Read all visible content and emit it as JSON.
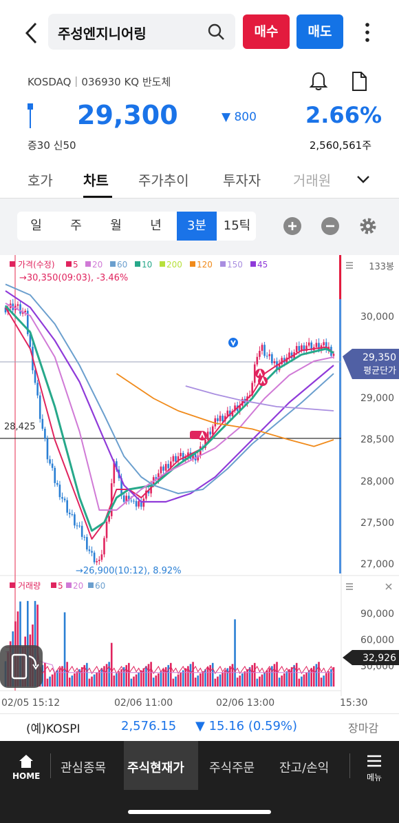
{
  "header": {
    "search_text": "주성엔지니어링",
    "buy_label": "매수",
    "sell_label": "매도"
  },
  "stock": {
    "market_line": "KOSDAQ｜036930 KQ 반도체",
    "price": "29,300",
    "change": "800",
    "change_pct": "2.66%",
    "margin": "증30  신50",
    "volume": "2,560,561주"
  },
  "tabs": [
    "호가",
    "차트",
    "주가추이",
    "투자자",
    "거래원"
  ],
  "period": [
    "일",
    "주",
    "월",
    "년",
    "3분",
    "15틱"
  ],
  "chart_data": {
    "type": "line",
    "legend": {
      "price": "가격(수정)",
      "ma": [
        "5",
        "20",
        "60",
        "10",
        "200",
        "120",
        "150",
        "45"
      ],
      "ma_colors": [
        "#e0245e",
        "#d07ad6",
        "#6b9fce",
        "#27a88a",
        "#b7e03b",
        "#f08a1a",
        "#a98ee0",
        "#8f3ad9"
      ]
    },
    "high_note": "→30,350(09:03), -3.46%",
    "low_note": "→26,900(10:12), 8.92%",
    "ref_level": "28,425",
    "bar_count": "133봉",
    "y_ticks": [
      "30,000",
      "29,500",
      "29,000",
      "28,500",
      "28,000",
      "27,500",
      "27,000"
    ],
    "ylim": [
      26900,
      30550
    ],
    "current_price": "29,350",
    "avg_label": "평균단가",
    "volume": {
      "legend_label": "거래량",
      "ma": [
        "5",
        "20",
        "60"
      ],
      "y_ticks": [
        "90,000",
        "60,000",
        "30,000"
      ],
      "current": "32,926"
    },
    "x_ticks": [
      "02/05 15:12",
      "02/06 11:00",
      "02/06 13:00",
      "15:30"
    ],
    "price_path": [
      [
        0,
        30100
      ],
      [
        4,
        30120
      ],
      [
        8,
        30000
      ],
      [
        11,
        29400
      ],
      [
        14,
        28800
      ],
      [
        17,
        28300
      ],
      [
        20,
        28000
      ],
      [
        23,
        27800
      ],
      [
        26,
        27600
      ],
      [
        29,
        27450
      ],
      [
        32,
        27300
      ],
      [
        35,
        27100
      ],
      [
        38,
        27000
      ],
      [
        40,
        27300
      ],
      [
        42,
        27600
      ],
      [
        44,
        28300
      ],
      [
        46,
        28000
      ],
      [
        48,
        27750
      ],
      [
        50,
        27800
      ],
      [
        52,
        27700
      ],
      [
        55,
        27750
      ],
      [
        58,
        27900
      ],
      [
        61,
        28050
      ],
      [
        64,
        28150
      ],
      [
        67,
        28250
      ],
      [
        70,
        28300
      ],
      [
        73,
        28280
      ],
      [
        76,
        28300
      ],
      [
        78,
        28320
      ],
      [
        80,
        28450
      ],
      [
        83,
        28600
      ],
      [
        86,
        28750
      ],
      [
        89,
        28800
      ],
      [
        92,
        28850
      ],
      [
        95,
        28900
      ],
      [
        98,
        29000
      ],
      [
        100,
        29200
      ],
      [
        102,
        29550
      ],
      [
        104,
        29600
      ],
      [
        106,
        29500
      ],
      [
        108,
        29450
      ],
      [
        110,
        29400
      ],
      [
        113,
        29480
      ],
      [
        116,
        29520
      ],
      [
        119,
        29600
      ],
      [
        122,
        29650
      ],
      [
        125,
        29620
      ],
      [
        128,
        29630
      ],
      [
        131,
        29600
      ],
      [
        133,
        29550
      ]
    ],
    "ma_paths": {
      "ma5": [
        [
          0,
          30100
        ],
        [
          10,
          29600
        ],
        [
          20,
          28500
        ],
        [
          30,
          27700
        ],
        [
          35,
          27300
        ],
        [
          40,
          27500
        ],
        [
          45,
          27900
        ],
        [
          50,
          27900
        ],
        [
          55,
          27800
        ],
        [
          60,
          27950
        ],
        [
          70,
          28250
        ],
        [
          80,
          28400
        ],
        [
          90,
          28780
        ],
        [
          100,
          29050
        ],
        [
          105,
          29300
        ],
        [
          110,
          29400
        ],
        [
          120,
          29580
        ],
        [
          130,
          29620
        ],
        [
          133,
          29550
        ]
      ],
      "ma10": [
        [
          0,
          30120
        ],
        [
          10,
          29800
        ],
        [
          20,
          28900
        ],
        [
          30,
          27800
        ],
        [
          35,
          27400
        ],
        [
          40,
          27500
        ],
        [
          45,
          27800
        ],
        [
          50,
          27900
        ],
        [
          60,
          27950
        ],
        [
          70,
          28200
        ],
        [
          80,
          28400
        ],
        [
          90,
          28700
        ],
        [
          100,
          29000
        ],
        [
          105,
          29200
        ],
        [
          110,
          29350
        ],
        [
          120,
          29530
        ],
        [
          130,
          29600
        ],
        [
          133,
          29550
        ]
      ],
      "ma20": [
        [
          0,
          30150
        ],
        [
          10,
          30000
        ],
        [
          20,
          29500
        ],
        [
          30,
          28600
        ],
        [
          38,
          27650
        ],
        [
          45,
          27650
        ],
        [
          55,
          27900
        ],
        [
          65,
          28100
        ],
        [
          75,
          28250
        ],
        [
          85,
          28400
        ],
        [
          95,
          28650
        ],
        [
          105,
          29000
        ],
        [
          115,
          29280
        ],
        [
          125,
          29450
        ],
        [
          133,
          29500
        ]
      ],
      "ma45": [
        [
          0,
          30300
        ],
        [
          10,
          30100
        ],
        [
          20,
          29700
        ],
        [
          30,
          29200
        ],
        [
          40,
          28500
        ],
        [
          48,
          27950
        ],
        [
          55,
          27750
        ],
        [
          65,
          27750
        ],
        [
          75,
          27850
        ],
        [
          85,
          28050
        ],
        [
          95,
          28350
        ],
        [
          105,
          28650
        ],
        [
          115,
          28950
        ],
        [
          125,
          29200
        ],
        [
          133,
          29400
        ]
      ],
      "ma60": [
        [
          0,
          30380
        ],
        [
          10,
          30250
        ],
        [
          20,
          29900
        ],
        [
          30,
          29400
        ],
        [
          40,
          28800
        ],
        [
          48,
          28300
        ],
        [
          55,
          28050
        ],
        [
          60,
          27950
        ],
        [
          70,
          27850
        ],
        [
          80,
          27900
        ],
        [
          90,
          28150
        ],
        [
          100,
          28450
        ],
        [
          110,
          28700
        ],
        [
          120,
          28950
        ],
        [
          133,
          29300
        ]
      ],
      "ma120": [
        [
          45,
          29300
        ],
        [
          60,
          29000
        ],
        [
          70,
          28850
        ],
        [
          85,
          28700
        ],
        [
          100,
          28630
        ],
        [
          115,
          28500
        ],
        [
          125,
          28420
        ],
        [
          133,
          28500
        ]
      ],
      "ma150": [
        [
          73,
          29150
        ],
        [
          85,
          29050
        ],
        [
          95,
          28980
        ],
        [
          110,
          28900
        ],
        [
          120,
          28880
        ],
        [
          133,
          28850
        ]
      ]
    }
  },
  "kospi": {
    "name": "(예)KOSPI",
    "value": "2,576.15",
    "change": "▼ 15.16 (0.59%)",
    "status": "장마감"
  },
  "nav": {
    "home": "HOME",
    "watch": "관심종목",
    "current": "주식현재가",
    "order": "주식주문",
    "balance": "잔고/손익",
    "menu": "메뉴"
  }
}
